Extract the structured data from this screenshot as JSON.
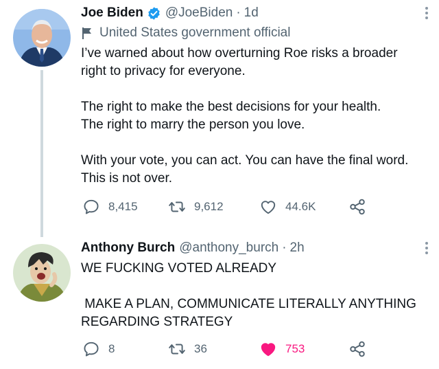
{
  "tweets": [
    {
      "author_name": "Joe Biden",
      "handle": "@JoeBiden",
      "time": "1d",
      "label": "United States government official",
      "paragraphs": [
        "I’ve warned about how overturning Roe risks a broader right to privacy for everyone.",
        "The right to make the best decisions for your health.",
        "The right to marry the person you love.",
        "With your vote, you can act. You can have the final word.",
        "This is not over."
      ],
      "replies": "8,415",
      "retweets": "9,612",
      "likes": "44.6K"
    },
    {
      "author_name": "Anthony Burch",
      "handle": "@anthony_burch",
      "time": "2h",
      "paragraphs": [
        "WE FUCKING VOTED ALREADY",
        " MAKE A PLAN, COMMUNICATE LITERALLY ANYTHING REGARDING STRATEGY"
      ],
      "replies": "8",
      "retweets": "36",
      "likes": "753"
    }
  ],
  "separator": "·",
  "colors": {
    "verified": "#1d9bf0",
    "muted": "#536471",
    "liked": "#f91880",
    "thread_line": "#cfd9de"
  },
  "icons": {
    "reply": "reply-icon",
    "retweet": "retweet-icon",
    "like": "heart-icon",
    "share": "share-icon",
    "more": "more-options-icon",
    "verified": "verified-badge-icon",
    "label": "flag-icon"
  }
}
